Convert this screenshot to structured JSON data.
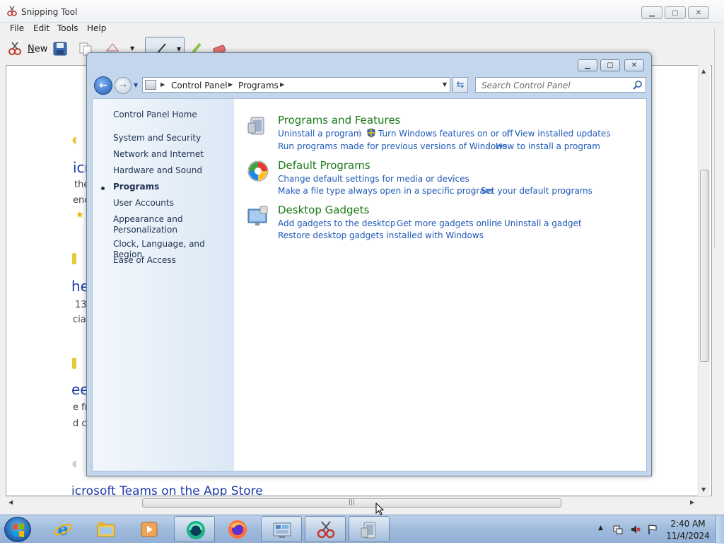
{
  "snipping_tool": {
    "title": "Snipping Tool",
    "menu": [
      "File",
      "Edit",
      "Tools",
      "Help"
    ],
    "toolbar": {
      "new_label": "New"
    },
    "background_page": {
      "fragments": [
        "icr",
        "the",
        "enc",
        "he",
        "13",
        "cia",
        "ee",
        "e fr",
        "d co"
      ],
      "bottom_line": "icrosoft Teams on the App Store"
    }
  },
  "control_panel": {
    "breadcrumb": [
      "Control Panel",
      "Programs"
    ],
    "search_placeholder": "Search Control Panel",
    "nav": {
      "home": "Control Panel Home",
      "items": [
        "System and Security",
        "Network and Internet",
        "Hardware and Sound",
        "Programs",
        "User Accounts",
        "Appearance and",
        "Personalization",
        "Clock, Language, and Region",
        "Ease of Access"
      ],
      "active": "Programs"
    },
    "categories": [
      {
        "title": "Programs and Features",
        "icon": "programs-features-icon",
        "links_row1": [
          "Uninstall a program",
          "Turn Windows features on or off",
          "View installed updates"
        ],
        "links_row2": [
          "Run programs made for previous versions of Windows",
          "How to install a program"
        ]
      },
      {
        "title": "Default Programs",
        "icon": "default-programs-icon",
        "links_row1": [
          "Change default settings for media or devices"
        ],
        "links_row2": [
          "Make a file type always open in a specific program",
          "Set your default programs"
        ]
      },
      {
        "title": "Desktop Gadgets",
        "icon": "desktop-gadgets-icon",
        "links_row1": [
          "Add gadgets to the desktop",
          "Get more gadgets online",
          "Uninstall a gadget"
        ],
        "links_row2": [
          "Restore desktop gadgets installed with Windows"
        ]
      }
    ]
  },
  "taskbar": {
    "apps": [
      "internet-explorer-icon",
      "windows-explorer-icon",
      "media-player-icon",
      "app-icon",
      "firefox-icon",
      "control-panel-icon",
      "snipping-tool-icon",
      "programs-icon"
    ],
    "clock": {
      "time": "2:40 AM",
      "date": "11/4/2024"
    }
  },
  "colors": {
    "link": "#1d58b8",
    "category_title": "#1a7a1a",
    "window_frame": "#c4d6ec"
  }
}
